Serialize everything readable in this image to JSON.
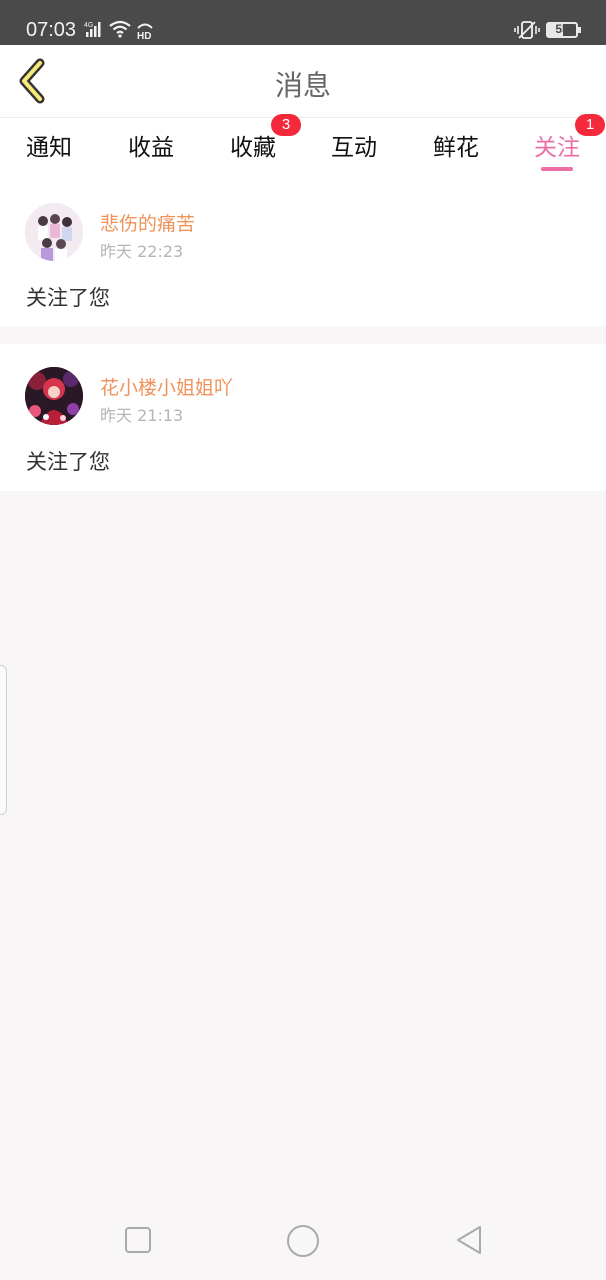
{
  "status_bar": {
    "time": "07:03",
    "network": "4G",
    "hd": "HD",
    "battery": "55"
  },
  "header": {
    "title": "消息"
  },
  "tabs": [
    {
      "label": "通知",
      "badge": ""
    },
    {
      "label": "收益",
      "badge": ""
    },
    {
      "label": "收藏",
      "badge": "3"
    },
    {
      "label": "互动",
      "badge": ""
    },
    {
      "label": "鲜花",
      "badge": ""
    },
    {
      "label": "关注",
      "badge": "1"
    }
  ],
  "active_tab": "关注",
  "messages": [
    {
      "username": "悲伤的痛苦",
      "time": "昨天 22:23",
      "text": "关注了您"
    },
    {
      "username": "花小楼小姐姐吖",
      "time": "昨天 21:13",
      "text": "关注了您"
    }
  ],
  "colors": {
    "accent": "#ec6ea7",
    "username": "#f0925a",
    "badge": "#f5293c",
    "back_arrow_fill": "#f7ea7a"
  },
  "icons": {
    "back": "chevron-left-icon",
    "nav_square": "recent-apps-icon",
    "nav_circle": "home-icon",
    "nav_triangle": "back-triangle-icon"
  }
}
